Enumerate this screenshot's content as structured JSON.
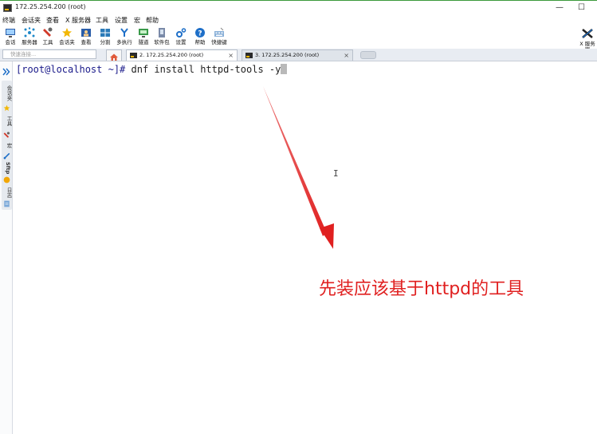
{
  "window": {
    "title": "172.25.254.200 (root)",
    "minimize": "—",
    "maximize": "☐"
  },
  "menu": [
    "终端",
    "会话夹",
    "查看",
    "X 服务器",
    "工具",
    "设置",
    "宏",
    "帮助"
  ],
  "toolbar": [
    {
      "label": "会话",
      "icon": "session-icon"
    },
    {
      "label": "服务器",
      "icon": "server-icon"
    },
    {
      "label": "工具",
      "icon": "tools-icon"
    },
    {
      "label": "会话夹",
      "icon": "star-icon"
    },
    {
      "label": "查看",
      "icon": "view-icon"
    },
    {
      "label": "分割",
      "icon": "split-icon"
    },
    {
      "label": "多执行",
      "icon": "multiexec-icon"
    },
    {
      "label": "隧道",
      "icon": "tunnel-icon"
    },
    {
      "label": "软件包",
      "icon": "package-icon"
    },
    {
      "label": "设置",
      "icon": "settings-icon"
    },
    {
      "label": "帮助",
      "icon": "help-icon"
    },
    {
      "label": "快捷键",
      "icon": "keyboard-icon"
    }
  ],
  "xserver": {
    "line1": "X 服务",
    "line2": "器"
  },
  "quickconnect": {
    "placeholder": "快速连接..."
  },
  "tabs": [
    {
      "label": "2. 172.25.254.200 (root)",
      "active": true
    },
    {
      "label": "3. 172.25.254.200 (root)",
      "active": false
    }
  ],
  "sidebar": [
    "会话夹",
    "工具",
    "宏",
    "Sftp",
    "日志"
  ],
  "terminal": {
    "prompt": "[root@localhost ~]# ",
    "command": "dnf install httpd-tools -y"
  },
  "annotation": "先装应该基于httpd的工具",
  "colors": {
    "annotation": "#e02020",
    "accent": "#3c9a3c"
  }
}
